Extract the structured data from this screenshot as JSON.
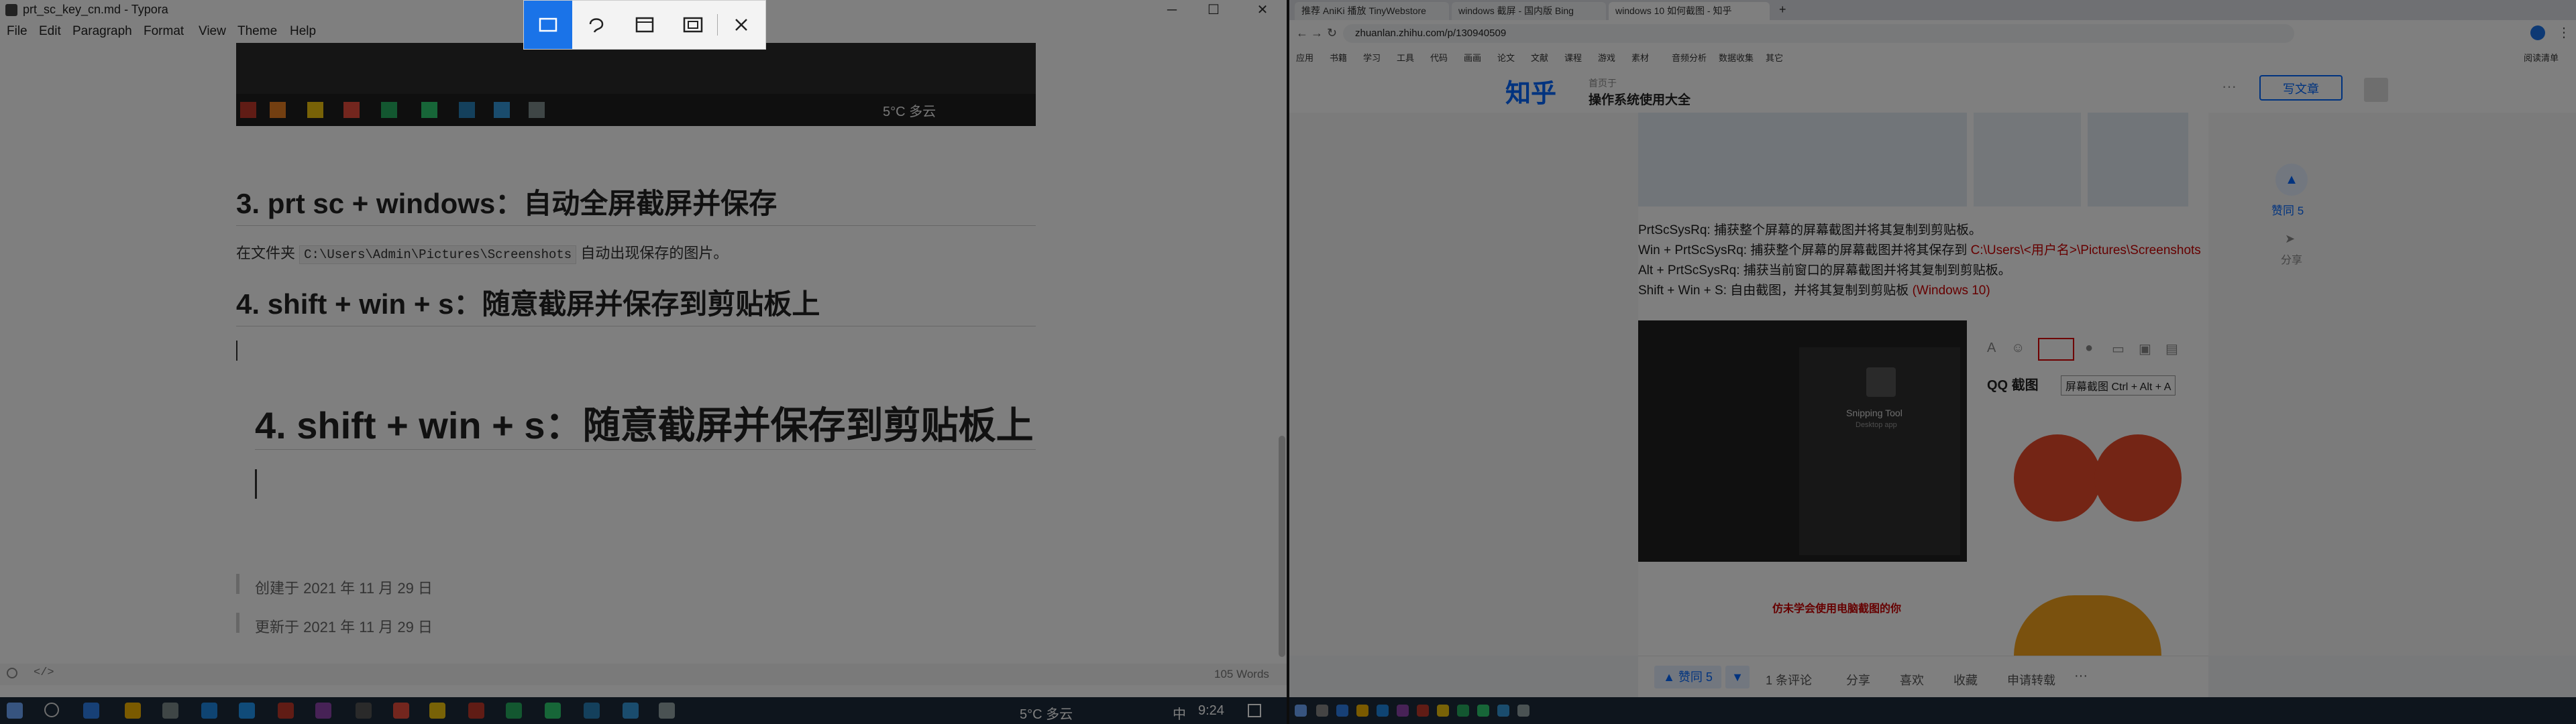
{
  "typora": {
    "window_title": "prt_sc_key_cn.md - Typora",
    "menu": [
      "File",
      "Edit",
      "Paragraph",
      "Format",
      "View",
      "Theme",
      "Help"
    ],
    "heading3": "3. prt sc + windows：自动全屏截屏并保存",
    "para_before_code": "在文件夹",
    "code_path": "C:\\Users\\Admin\\Pictures\\Screenshots",
    "para_after_code": "自动出现保存的图片。",
    "heading4": "4. shift + win + s：随意截屏并保存到剪贴板上",
    "heading4_big": "4. shift + win + s：随意截屏并保存到剪贴板上",
    "created": "创建于 2021 年 11 月 29 日",
    "updated": "更新于 2021 年 11 月 29 日",
    "word_count": "105 Words",
    "embedded_weather": "5°C  多云"
  },
  "snip_toolbar": {
    "modes": [
      "rectangular-snip",
      "freeform-snip",
      "window-snip",
      "fullscreen-snip",
      "close"
    ]
  },
  "browser": {
    "tabs": [
      "推荐 AniKi 播放 TinyWebstore",
      "windows 截屏 - 国内版 Bing",
      "windows 10 如何截图 - 知乎"
    ],
    "address": "zhuanlan.zhihu.com/p/130940509",
    "bookmarks": [
      "应用",
      "书籍",
      "学习",
      "工具",
      "代码",
      "画画",
      "论文",
      "文献",
      "课程",
      "游戏",
      "素材",
      "音频分析",
      "数据收集",
      "其它"
    ],
    "reading_list": "阅读清单",
    "zhihu_logo": "知乎",
    "column_label": "首页于",
    "column_title": "操作系统使用大全",
    "write_button": "写文章",
    "lines": [
      {
        "text": "PrtScSysRq: 捕获整个屏幕的屏幕截图并将其复制到剪贴板。"
      },
      {
        "pre": "Win + PrtScSysRq: 捕获整个屏幕的屏幕截图并将其保存到 ",
        "red": "C:\\Users\\<用户名>\\Pictures\\Screenshots"
      },
      {
        "text": "Alt + PrtScSysRq: 捕获当前窗口的屏幕截图并将其复制到剪贴板。"
      },
      {
        "pre": "Shift + Win + S: 自由截图，并将其复制到剪贴板 ",
        "red": "(Windows 10)"
      }
    ],
    "vote_up": "赞同 5",
    "share": "分享",
    "qq_label": "QQ 截图",
    "qq_tooltip": "屏幕截图 Ctrl + Alt + A",
    "meme_caption": "仿未学会使用电脑截图的你",
    "snip_panel_title": "Snipping Tool",
    "snip_panel_sub": "Desktop app",
    "footer": {
      "vote": "▲ 赞同 5",
      "comments": "1 条评论",
      "share": "分享",
      "like": "喜欢",
      "favorite": "收藏",
      "reprint": "申请转载",
      "more": "···"
    }
  },
  "taskbar": {
    "weather": "5°C  多云",
    "ime": "中",
    "time": "9:24"
  },
  "colors": {
    "zhihu_blue": "#0066ff",
    "snip_active": "#1a73e8",
    "taskbar": "#1c2a3a"
  }
}
